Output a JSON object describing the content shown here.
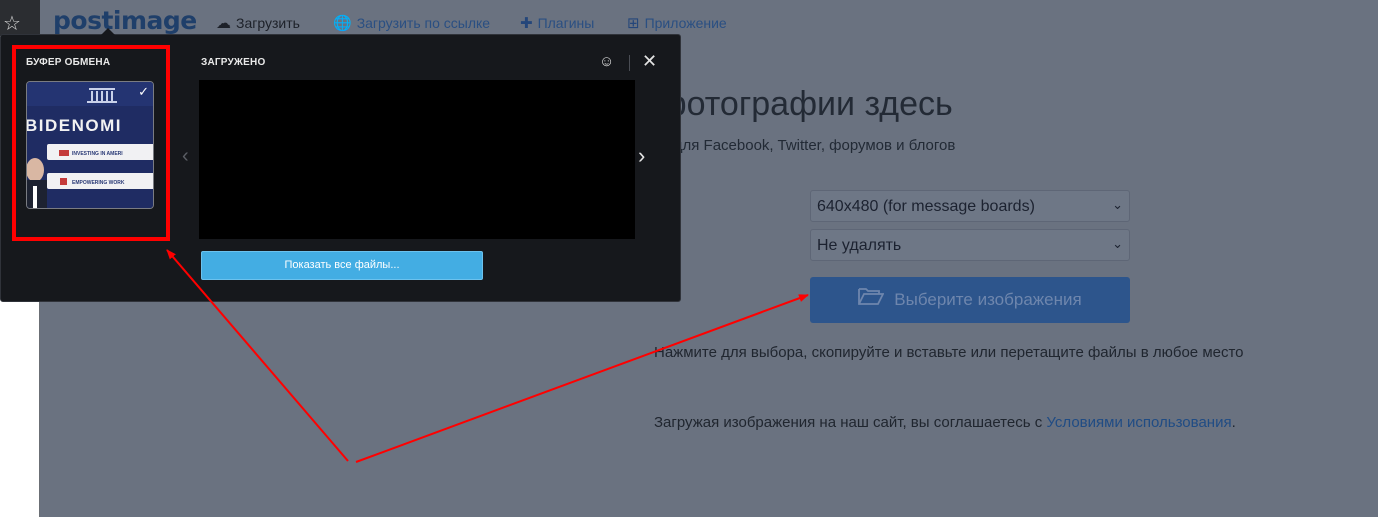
{
  "browser": {
    "star_icon": "star-outline-icon"
  },
  "header": {
    "logo": "postimage",
    "nav": [
      {
        "label": "Загрузить",
        "icon": "cloud-upload-icon"
      },
      {
        "label": "Загрузить по ссылке",
        "icon": "globe-icon"
      },
      {
        "label": "Плагины",
        "icon": "puzzle-icon"
      },
      {
        "label": "Приложение",
        "icon": "windows-icon"
      }
    ]
  },
  "hero": {
    "title": "Публикуйте фотографии здесь",
    "subtitle": "Получите постоянные ссылки для Facebook, Twitter, форумов и блогов"
  },
  "form": {
    "size_select": "640x480 (for message boards)",
    "expire_select": "Не удалять",
    "choose_button": "Выберите изображения",
    "hint": "Нажмите для выбора, скопируйте и вставьте или перетащите файлы в любое место",
    "terms_prefix": "Загружая изображения на наш сайт, вы соглашаетесь с ",
    "terms_link": "Условиями использования",
    "terms_suffix": "."
  },
  "popup": {
    "clipboard_label": "БУФЕР ОБМЕНА",
    "uploaded_label": "ЗАГРУЖЕНО",
    "show_all_button": "Показать все файлы...",
    "thumbnail_text": "BIDENOMI",
    "thumbnail_row1": "INVESTING IN AMERI",
    "thumbnail_row2": "EMPOWERING WORK"
  },
  "colors": {
    "overlay_page": "#6a7280",
    "popup_bg": "#16181c",
    "accent_button": "#43ade3",
    "annotation_red": "#ff0000"
  }
}
